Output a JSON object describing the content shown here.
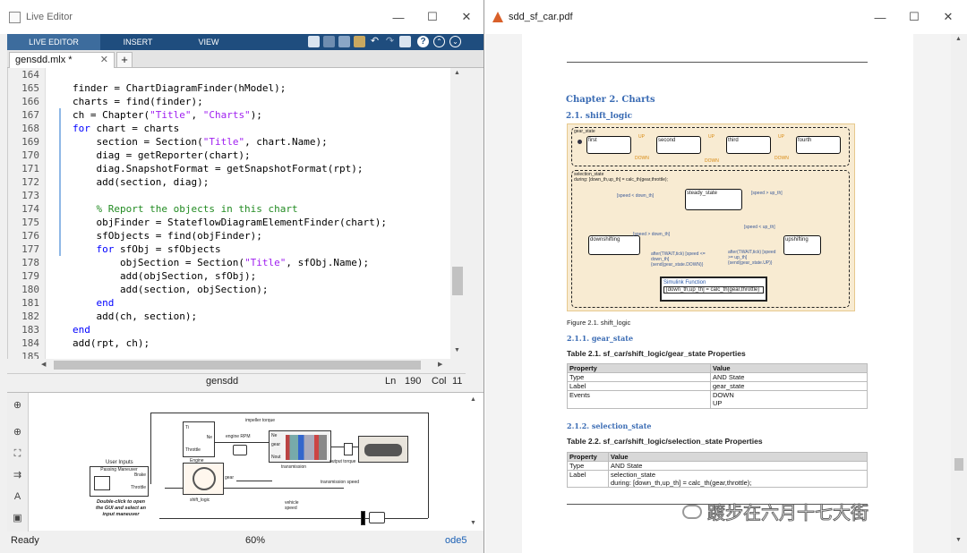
{
  "live_editor": {
    "window_title": "Live Editor",
    "ribbon_tabs": [
      "LIVE EDITOR",
      "INSERT",
      "VIEW"
    ],
    "file_tab": "gensdd.mlx *",
    "code_lines": [
      {
        "n": "164",
        "t": ""
      },
      {
        "n": "165",
        "t": "finder = ChartDiagramFinder(hModel);"
      },
      {
        "n": "166",
        "t": "charts = find(finder);"
      },
      {
        "n": "167",
        "t": "ch = Chapter(\"Title\", \"Charts\");"
      },
      {
        "n": "168",
        "t": "for chart = charts"
      },
      {
        "n": "169",
        "t": "    section = Section(\"Title\", chart.Name);"
      },
      {
        "n": "170",
        "t": "    diag = getReporter(chart);"
      },
      {
        "n": "171",
        "t": "    diag.SnapshotFormat = getSnapshotFormat(rpt);"
      },
      {
        "n": "172",
        "t": "    add(section, diag);"
      },
      {
        "n": "173",
        "t": ""
      },
      {
        "n": "174",
        "t": "    % Report the objects in this chart"
      },
      {
        "n": "175",
        "t": "    objFinder = StateflowDiagramElementFinder(chart);"
      },
      {
        "n": "176",
        "t": "    sfObjects = find(objFinder);"
      },
      {
        "n": "177",
        "t": "    for sfObj = sfObjects"
      },
      {
        "n": "178",
        "t": "        objSection = Section(\"Title\", sfObj.Name);"
      },
      {
        "n": "179",
        "t": "        add(objSection, sfObj);"
      },
      {
        "n": "180",
        "t": "        add(section, objSection);"
      },
      {
        "n": "181",
        "t": "    end"
      },
      {
        "n": "182",
        "t": "    add(ch, section);"
      },
      {
        "n": "183",
        "t": "end"
      },
      {
        "n": "184",
        "t": "add(rpt, ch);"
      },
      {
        "n": "185",
        "t": ""
      }
    ],
    "status_bar": {
      "name": "gensdd",
      "ln_label": "Ln",
      "ln": "190",
      "col_label": "Col",
      "col": "11"
    },
    "bottom_status": {
      "ready": "Ready",
      "zoom": "60%",
      "solver": "ode5"
    },
    "model": {
      "user_inputs": "User Inputs",
      "passing_maneuver": "Passing Maneuver",
      "brake": "Brake",
      "throttle": "Throttle",
      "gui_note": "Double-click to open the GUI and select an input maneuver",
      "engine": "Engine",
      "engine_rpm": "engine RPM",
      "impeller_torque": "impeller torque",
      "transmission": "transmission",
      "output_torque": "output torque",
      "transmission_speed": "transmission speed",
      "gear": "gear",
      "shift_logic": "shift_logic",
      "vehicle_speed": "vehicle speed",
      "ti": "Ti",
      "ne": "Ne",
      "nin": "Nin",
      "nout": "Nout",
      "tin": "Tin",
      "tout": "Tout"
    }
  },
  "pdf_viewer": {
    "window_title": "sdd_sf_car.pdf",
    "chapter": "Chapter 2. Charts",
    "section": "2.1. shift_logic",
    "diagram": {
      "gear_state_label": "gear_state",
      "states": [
        "first",
        "second",
        "third",
        "fourth"
      ],
      "up": "UP",
      "down": "DOWN",
      "selection_label": "selection_state",
      "selection_during": "during: [down_th,up_th] = calc_th(gear,throttle);",
      "steady": "steady_state",
      "downshifting": "downshifting",
      "upshifting": "upshifting",
      "speed_lt_down": "[speed < down_th]",
      "speed_gt_up": "[speed > up_th]",
      "after_down": "after(TWAIT,tick) [speed <= down_th] {send(gear_state.DOWN)}",
      "after_up": "after(TWAIT,tick) [speed >= up_th] {send(gear_state.UP)}",
      "function_title": "Simulink Function",
      "function_sig": "[down_th,up_th] = calc_th(gear,throttle)"
    },
    "figure_caption": "Figure 2.1. shift_logic",
    "sub1": "2.1.1. gear_state",
    "table1_title": "Table 2.1. sf_car/shift_logic/gear_state Properties",
    "table1": {
      "headers": [
        "Property",
        "Value"
      ],
      "rows": [
        [
          "Type",
          "AND State"
        ],
        [
          "Label",
          "gear_state"
        ],
        [
          "Events",
          "DOWN\nUP"
        ]
      ]
    },
    "sub2": "2.1.2. selection_state",
    "table2_title": "Table 2.2. sf_car/shift_logic/selection_state Properties",
    "table2": {
      "headers": [
        "Property",
        "Value"
      ],
      "rows": [
        [
          "Type",
          "AND State"
        ],
        [
          "Label",
          "selection_state\nduring: [down_th,up_th] = calc_th(gear,throttle);"
        ]
      ]
    },
    "watermark": "踱步在六月十七大街"
  }
}
